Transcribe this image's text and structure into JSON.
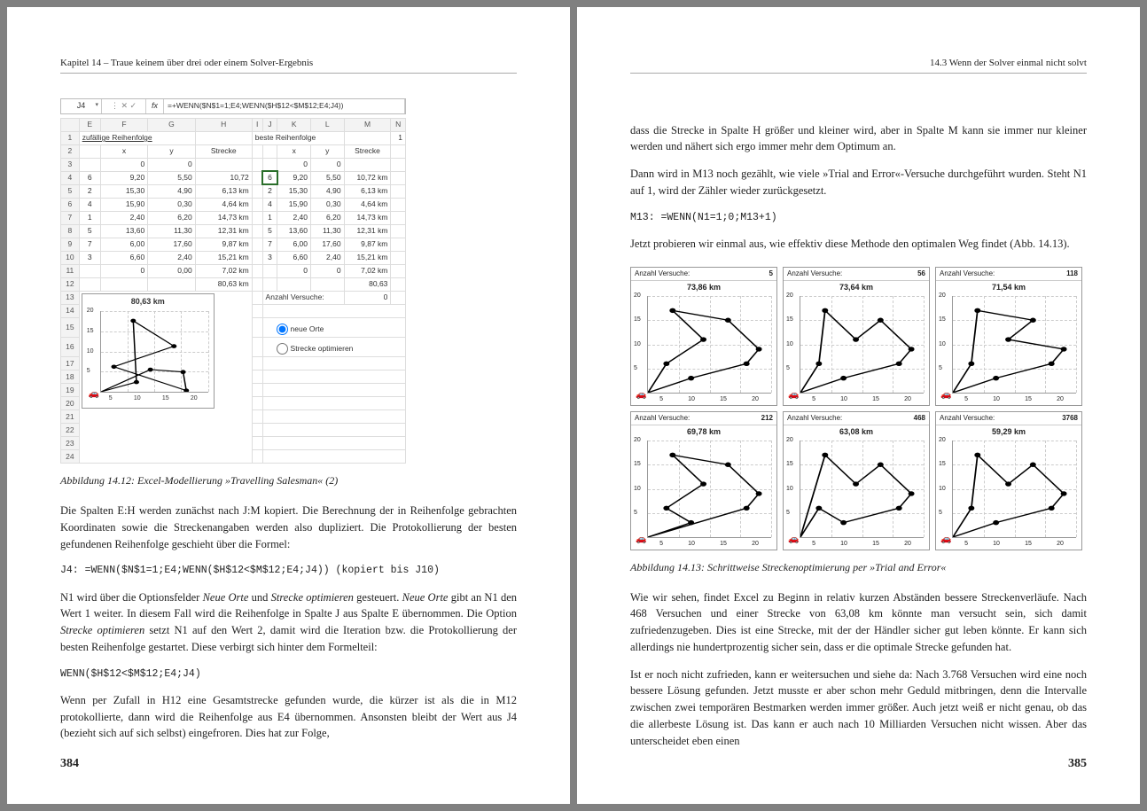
{
  "left": {
    "header": "Kapitel 14  –  Traue keinem über drei oder einem Solver-Ergebnis",
    "pageNum": "384",
    "excel": {
      "cellRef": "J4",
      "fxIcons": "⋮  ✕  ✓",
      "fxLabel": "fx",
      "formula": "=+WENN($N$1=1;E4;WENN($H$12<$M$12;E4;J4))",
      "cols": [
        "",
        "E",
        "F",
        "G",
        "H",
        "I",
        "J",
        "K",
        "L",
        "M",
        "N"
      ],
      "row1_a": "zufällige Reihenfolge",
      "row1_b": "beste Reihenfolge",
      "row1_n": "1",
      "hdrs": {
        "x1": "x",
        "y1": "y",
        "s1": "Strecke",
        "x2": "x",
        "y2": "y",
        "s2": "Strecke"
      },
      "row3": {
        "a": "0",
        "b": "0",
        "c": "0",
        "d": "0"
      },
      "dataRows": [
        {
          "r": "4",
          "e": "6",
          "f": "9,20",
          "g": "5,50",
          "h": "10,72",
          "j": "6",
          "k": "9,20",
          "l": "5,50",
          "m": "10,72 km"
        },
        {
          "r": "5",
          "e": "2",
          "f": "15,30",
          "g": "4,90",
          "h": "6,13 km",
          "j": "2",
          "k": "15,30",
          "l": "4,90",
          "m": "6,13 km"
        },
        {
          "r": "6",
          "e": "4",
          "f": "15,90",
          "g": "0,30",
          "h": "4,64 km",
          "j": "4",
          "k": "15,90",
          "l": "0,30",
          "m": "4,64 km"
        },
        {
          "r": "7",
          "e": "1",
          "f": "2,40",
          "g": "6,20",
          "h": "14,73 km",
          "j": "1",
          "k": "2,40",
          "l": "6,20",
          "m": "14,73 km"
        },
        {
          "r": "8",
          "e": "5",
          "f": "13,60",
          "g": "11,30",
          "h": "12,31 km",
          "j": "5",
          "k": "13,60",
          "l": "11,30",
          "m": "12,31 km"
        },
        {
          "r": "9",
          "e": "7",
          "f": "6,00",
          "g": "17,60",
          "h": "9,87 km",
          "j": "7",
          "k": "6,00",
          "l": "17,60",
          "m": "9,87 km"
        },
        {
          "r": "10",
          "e": "3",
          "f": "6,60",
          "g": "2,40",
          "h": "15,21 km",
          "j": "3",
          "k": "6,60",
          "l": "2,40",
          "m": "15,21 km"
        }
      ],
      "row11": {
        "f": "0",
        "g": "0,00",
        "h": "7,02 km",
        "k": "0",
        "l": "0",
        "m": "7,02 km"
      },
      "row12": {
        "h": "80,63 km",
        "m": "80,63"
      },
      "row13_label": "Anzahl Versuche:",
      "row13_val": "0",
      "chartTitle": "80,63 km",
      "radio1": "neue Orte",
      "radio2": "Strecke optimieren",
      "yticks": [
        "20",
        "15",
        "10",
        "5"
      ],
      "xticks": [
        "5",
        "10",
        "15",
        "20"
      ]
    },
    "caption1": "Abbildung 14.12: Excel-Modellierung »Travelling Salesman« (2)",
    "p1": "Die Spalten E:H werden zunächst nach J:M kopiert. Die Berechnung der in Reihenfolge gebrachten Koordinaten sowie die Streckenangaben werden also dupliziert. Die Protokollierung der besten gefundenen Reihenfolge geschieht über die Formel:",
    "code1": "J4: =WENN($N$1=1;E4;WENN($H$12<$M$12;E4;J4)) (kopiert bis J10)",
    "p2a": "N1 wird über die Optionsfelder ",
    "p2b": "Neue Orte",
    "p2c": " und ",
    "p2d": "Strecke optimieren",
    "p2e": " gesteuert. ",
    "p2f": "Neue Orte",
    "p2g": " gibt an N1 den Wert 1 weiter. In diesem Fall wird die Reihenfolge in Spalte J aus Spalte E übernommen. Die Option ",
    "p2h": "Strecke optimieren",
    "p2i": " setzt N1 auf den Wert 2, damit wird die Iteration bzw. die Protokollierung der besten Reihenfolge gestartet. Diese verbirgt sich hinter dem Formelteil:",
    "code2": "WENN($H$12<$M$12;E4;J4)",
    "p3": "Wenn per Zufall in H12 eine Gesamtstrecke gefunden wurde, die kürzer ist als die in M12 protokollierte, dann wird die Reihenfolge aus E4 übernommen. Ansonsten bleibt der Wert aus J4 (bezieht sich auf sich selbst) eingefroren. Dies hat zur Folge,"
  },
  "right": {
    "header": "14.3  Wenn der Solver einmal nicht solvt",
    "pageNum": "385",
    "p1": "dass die Strecke in Spalte H größer und kleiner wird, aber in Spalte M kann sie immer nur kleiner werden und nähert sich ergo immer mehr dem Optimum an.",
    "p2": "Dann wird in M13 noch gezählt, wie viele »Trial and Error«-Versuche durchgeführt wurden. Steht N1 auf 1, wird der Zähler wieder zurückgesetzt.",
    "code1": "M13: =WENN(N1=1;0;M13+1)",
    "p3": "Jetzt probieren wir einmal aus, wie effektiv diese Methode den optimalen Weg findet (Abb. 14.13).",
    "panelsLabel": "Anzahl Versuche:",
    "panels": [
      {
        "n": "5",
        "km": "73,86 km"
      },
      {
        "n": "56",
        "km": "73,64 km"
      },
      {
        "n": "118",
        "km": "71,54 km"
      },
      {
        "n": "212",
        "km": "69,78 km"
      },
      {
        "n": "468",
        "km": "63,08 km"
      },
      {
        "n": "3768",
        "km": "59,29 km"
      }
    ],
    "yticks": [
      "20",
      "15",
      "10",
      "5"
    ],
    "xticks": [
      "5",
      "10",
      "15",
      "20"
    ],
    "caption": "Abbildung 14.13: Schrittweise Streckenoptimierung per »Trial and Error«",
    "p4": "Wie wir sehen, findet Excel zu Beginn in relativ kurzen Abständen bessere Streckenverläufe. Nach 468 Versuchen und einer Strecke von 63,08 km könnte man versucht sein, sich damit zufriedenzugeben. Dies ist eine Strecke, mit der der Händler sicher gut leben könnte. Er kann sich allerdings nie hundertprozentig sicher sein, dass er die optimale Strecke gefunden hat.",
    "p5": "Ist er noch nicht zufrieden, kann er weitersuchen und siehe da: Nach 3.768 Versuchen wird eine noch bessere Lösung gefunden. Jetzt musste er aber schon mehr Geduld mitbringen, denn die Intervalle zwischen zwei temporären Bestmarken werden immer größer. Auch jetzt weiß er nicht genau, ob das die allerbeste Lösung ist. Das kann er auch nach 10 Milliarden Versuchen nicht wissen. Aber das unterscheidet eben einen"
  },
  "chart_data": [
    {
      "type": "scatter",
      "title": "80,63 km (Abb. 14.12 inset)",
      "xlim": [
        0,
        20
      ],
      "ylim": [
        0,
        20
      ],
      "points": [
        [
          9.2,
          5.5
        ],
        [
          15.3,
          4.9
        ],
        [
          15.9,
          0.3
        ],
        [
          2.4,
          6.2
        ],
        [
          13.6,
          11.3
        ],
        [
          6.0,
          17.6
        ],
        [
          6.6,
          2.4
        ]
      ],
      "path_order": [
        6,
        2,
        4,
        1,
        5,
        7,
        3
      ],
      "origin": [
        0,
        0
      ]
    },
    {
      "type": "scatter",
      "title": "Anzahl Versuche: 5 — 73,86 km",
      "xlim": [
        0,
        20
      ],
      "ylim": [
        0,
        20
      ],
      "points": [
        [
          3,
          6
        ],
        [
          4,
          17
        ],
        [
          7,
          3
        ],
        [
          9,
          11
        ],
        [
          13,
          15
        ],
        [
          16,
          6
        ],
        [
          18,
          9
        ]
      ]
    },
    {
      "type": "scatter",
      "title": "Anzahl Versuche: 56 — 73,64 km",
      "xlim": [
        0,
        20
      ],
      "ylim": [
        0,
        20
      ],
      "points": [
        [
          3,
          6
        ],
        [
          4,
          17
        ],
        [
          7,
          3
        ],
        [
          9,
          11
        ],
        [
          13,
          15
        ],
        [
          16,
          6
        ],
        [
          18,
          9
        ]
      ]
    },
    {
      "type": "scatter",
      "title": "Anzahl Versuche: 118 — 71,54 km",
      "xlim": [
        0,
        20
      ],
      "ylim": [
        0,
        20
      ],
      "points": [
        [
          3,
          6
        ],
        [
          4,
          17
        ],
        [
          7,
          3
        ],
        [
          9,
          11
        ],
        [
          13,
          15
        ],
        [
          16,
          6
        ],
        [
          18,
          9
        ]
      ]
    },
    {
      "type": "scatter",
      "title": "Anzahl Versuche: 212 — 69,78 km",
      "xlim": [
        0,
        20
      ],
      "ylim": [
        0,
        20
      ],
      "points": [
        [
          3,
          6
        ],
        [
          4,
          17
        ],
        [
          7,
          3
        ],
        [
          9,
          11
        ],
        [
          13,
          15
        ],
        [
          16,
          6
        ],
        [
          18,
          9
        ]
      ]
    },
    {
      "type": "scatter",
      "title": "Anzahl Versuche: 468 — 63,08 km",
      "xlim": [
        0,
        20
      ],
      "ylim": [
        0,
        20
      ],
      "points": [
        [
          3,
          6
        ],
        [
          4,
          17
        ],
        [
          7,
          3
        ],
        [
          9,
          11
        ],
        [
          13,
          15
        ],
        [
          16,
          6
        ],
        [
          18,
          9
        ]
      ]
    },
    {
      "type": "scatter",
      "title": "Anzahl Versuche: 3768 — 59,29 km",
      "xlim": [
        0,
        20
      ],
      "ylim": [
        0,
        20
      ],
      "points": [
        [
          3,
          6
        ],
        [
          4,
          17
        ],
        [
          7,
          3
        ],
        [
          9,
          11
        ],
        [
          13,
          15
        ],
        [
          16,
          6
        ],
        [
          18,
          9
        ]
      ]
    }
  ]
}
